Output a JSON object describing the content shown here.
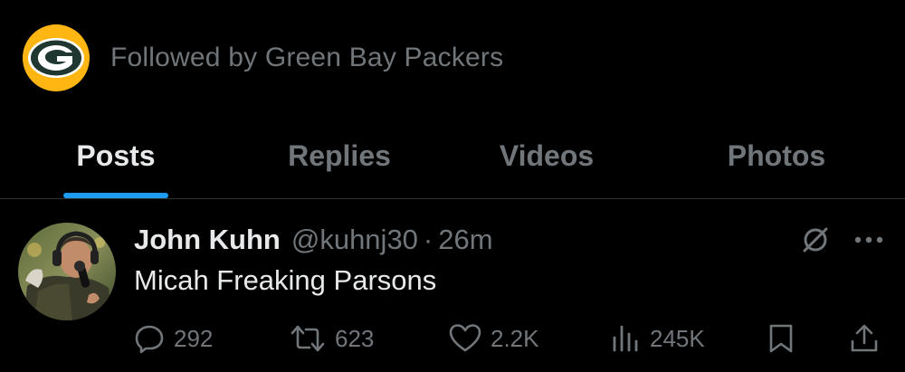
{
  "profile": {
    "followed_by_text": "Followed by Green Bay Packers"
  },
  "tabs": [
    {
      "label": "Posts",
      "active": true
    },
    {
      "label": "Replies",
      "active": false
    },
    {
      "label": "Videos",
      "active": false
    },
    {
      "label": "Photos",
      "active": false
    }
  ],
  "tweet": {
    "author_name": "John Kuhn",
    "handle": "@kuhnj30",
    "separator": "·",
    "time": "26m",
    "text": "Micah Freaking Parsons",
    "replies": "292",
    "reposts": "623",
    "likes": "2.2K",
    "views": "245K"
  },
  "icons": {
    "grok": "grok-icon",
    "more": "more-icon",
    "reply": "reply-icon",
    "repost": "repost-icon",
    "like": "heart-icon",
    "views": "views-icon",
    "bookmark": "bookmark-icon",
    "share": "share-icon"
  },
  "colors": {
    "background": "#000000",
    "primary_text": "#e7e9ea",
    "secondary_text": "#71767b",
    "accent": "#1d9bf0",
    "divider": "#2f3336",
    "packers_green": "#203731",
    "packers_gold": "#ffb612"
  }
}
